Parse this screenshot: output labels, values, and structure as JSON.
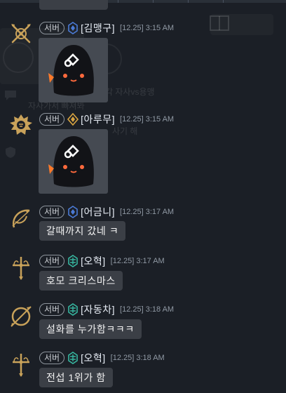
{
  "server_badge": "서버",
  "background_ghost_text": [
    "각 자사vs용맹",
    "자사가서 빠져봐",
    "사기 해"
  ],
  "messages": [
    {
      "name": "[김맹구]",
      "time": "[12.25] 3:15 AM",
      "kind": "sticker",
      "emblem": "crossed-guns-emblem",
      "rank_color": "#4b7bd6"
    },
    {
      "name": "[아루무]",
      "time": "[12.25] 3:15 AM",
      "kind": "sticker",
      "emblem": "lion-emblem",
      "rank_color": "#d9a441"
    },
    {
      "name": "[어금니]",
      "time": "[12.25] 3:17 AM",
      "kind": "text",
      "text": "갈때까지 갔네 ㅋ",
      "emblem": "bow-emblem",
      "rank_color": "#4b7bd6"
    },
    {
      "name": "[오혁]",
      "time": "[12.25] 3:17 AM",
      "kind": "text",
      "text": "호모 크리스마스",
      "emblem": "sword-emblem",
      "rank_color": "#37b7a0"
    },
    {
      "name": "[자동차]",
      "time": "[12.25] 3:18 AM",
      "kind": "text",
      "text": "설화를 누가함ㅋㅋㅋ",
      "emblem": "bow-emblem",
      "rank_color": "#37b7a0"
    },
    {
      "name": "[오혁]",
      "time": "[12.25] 3:18 AM",
      "kind": "text",
      "text": "전섭 1위가 함",
      "emblem": "sword-emblem",
      "rank_color": "#37b7a0"
    }
  ],
  "colors": {
    "background": "#1b1f26",
    "bubble": "#3b3f46",
    "sticker_bg": "#454a52",
    "emblem_gold": "#c9a25a",
    "ghost_eye": "#ff6a3d"
  }
}
